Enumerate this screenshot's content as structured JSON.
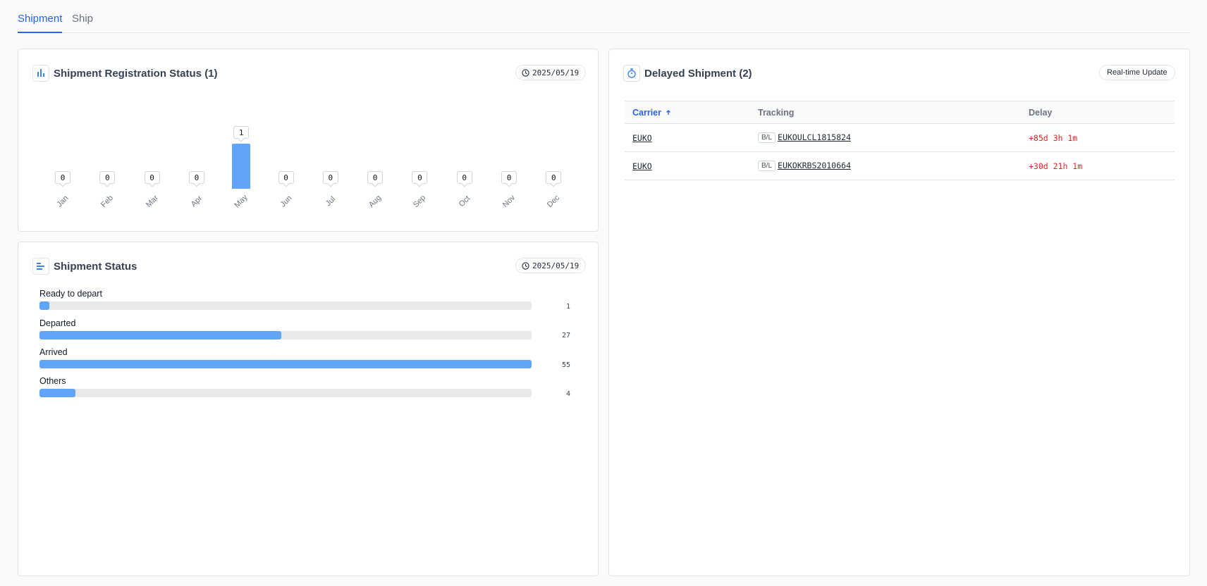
{
  "tabs": [
    {
      "label": "Shipment",
      "active": true
    },
    {
      "label": "Ship",
      "active": false
    }
  ],
  "registration": {
    "title": "Shipment Registration Status (1)",
    "date": "2025/05/19",
    "icon": "bar-chart-icon"
  },
  "chart_data": {
    "type": "bar",
    "categories": [
      "Jan",
      "Feb",
      "Mar",
      "Apr",
      "May",
      "Jun",
      "Jul",
      "Aug",
      "Sep",
      "Oct",
      "Nov",
      "Dec"
    ],
    "values": [
      0,
      0,
      0,
      0,
      1,
      0,
      0,
      0,
      0,
      0,
      0,
      0
    ],
    "ylim": [
      0,
      1
    ],
    "grid": false,
    "color": "#60a5fa"
  },
  "status": {
    "title": "Shipment Status",
    "date": "2025/05/19",
    "icon": "horizontal-bars-icon",
    "max": 55,
    "items": [
      {
        "label": "Ready to depart",
        "count": "1",
        "value": 1
      },
      {
        "label": "Departed",
        "count": "27",
        "value": 27
      },
      {
        "label": "Arrived",
        "count": "55",
        "value": 55
      },
      {
        "label": "Others",
        "count": "4",
        "value": 4
      }
    ]
  },
  "delayed": {
    "title": "Delayed Shipment (2)",
    "badge": "Real-time Update",
    "icon": "stopwatch-icon",
    "columns": {
      "carrier": "Carrier",
      "tracking": "Tracking",
      "delay": "Delay"
    },
    "sort_icon": "arrow-up-icon",
    "rows": [
      {
        "carrier": "EUKO",
        "tag": "B/L",
        "tracking": "EUKOULCL1815824",
        "delay": "+85d 3h 1m"
      },
      {
        "carrier": "EUKO",
        "tag": "B/L",
        "tracking": "EUKOKRBS2010664",
        "delay": "+30d 21h 1m"
      }
    ]
  },
  "colors": {
    "accent": "#2563eb",
    "bar": "#60a5fa",
    "delay": "#dc2626"
  }
}
